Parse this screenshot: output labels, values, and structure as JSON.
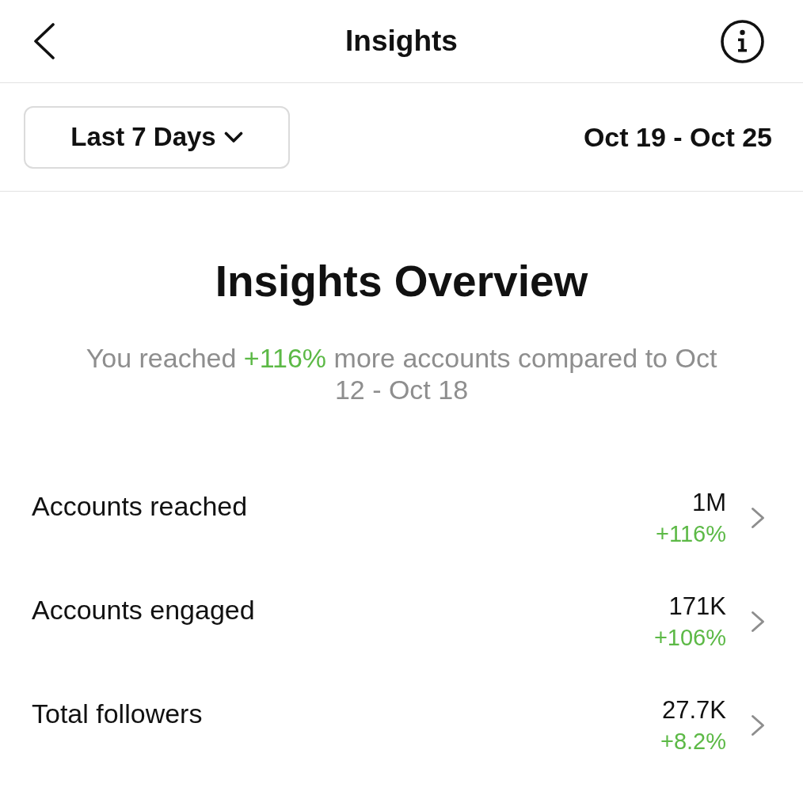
{
  "header": {
    "title": "Insights"
  },
  "period_selector": {
    "label": "Last 7 Days"
  },
  "date_range": "Oct 19 - Oct 25",
  "overview": {
    "title": "Insights Overview",
    "summary": [
      {
        "text": "You reached ",
        "kind": "plain"
      },
      {
        "text": "+116%",
        "kind": "positive"
      },
      {
        "text": " more accounts compared to Oct 12 - Oct 18",
        "kind": "plain"
      }
    ]
  },
  "metrics": [
    {
      "label": "Accounts reached",
      "value": "1M",
      "change": "+116%",
      "increase": true
    },
    {
      "label": "Accounts engaged",
      "value": "171K",
      "change": "+106%",
      "increase": true
    },
    {
      "label": "Total followers",
      "value": "27.7K",
      "change": "+8.2%",
      "increase": true
    }
  ]
}
